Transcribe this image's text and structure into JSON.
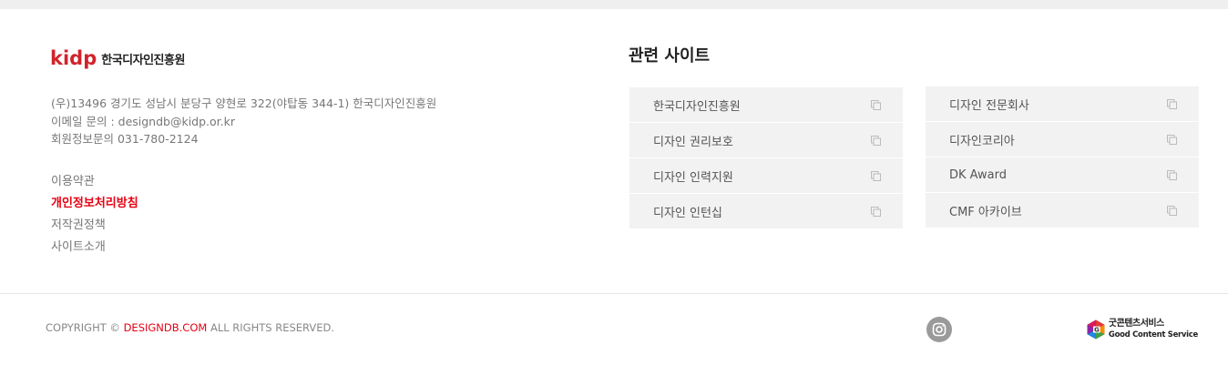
{
  "logo": {
    "mark": "kidp",
    "org_name": "한국디자인진흥원"
  },
  "contact": {
    "address": "(우)13496 경기도 성남시 분당구 양현로 322(야탑동 344-1) 한국디자인진흥원",
    "email": "이메일 문의 : designdb@kidp.or.kr",
    "phone": "회원정보문의 031-780-2124"
  },
  "footer_links": [
    {
      "label": "이용약관"
    },
    {
      "label": "개인정보처리방침",
      "highlight": true
    },
    {
      "label": "저작권정책"
    },
    {
      "label": "사이트소개"
    }
  ],
  "related": {
    "title": "관련 사이트",
    "left": [
      {
        "label": "한국디자인진흥원"
      },
      {
        "label": "디자인 권리보호"
      },
      {
        "label": "디자인 인력지원"
      },
      {
        "label": "디자인 인턴십"
      }
    ],
    "right": [
      {
        "label": "디자인 전문회사"
      },
      {
        "label": "디자인코리아"
      },
      {
        "label": "DK Award"
      },
      {
        "label": "CMF 아카이브"
      }
    ]
  },
  "copyright": {
    "prefix": "COPYRIGHT © ",
    "brand": "DESIGNDB.COM",
    "suffix": " ALL RIGHTS RESERVED."
  },
  "gcs_badge": {
    "korean": "굿콘텐츠서비스",
    "english": "Good Content Service"
  },
  "icons": {
    "external_link": "external-link-icon",
    "instagram": "instagram-icon"
  },
  "colors": {
    "accent": "#e60012",
    "logo_red": "#d2232a",
    "panel_bg": "#f2f2f2"
  }
}
